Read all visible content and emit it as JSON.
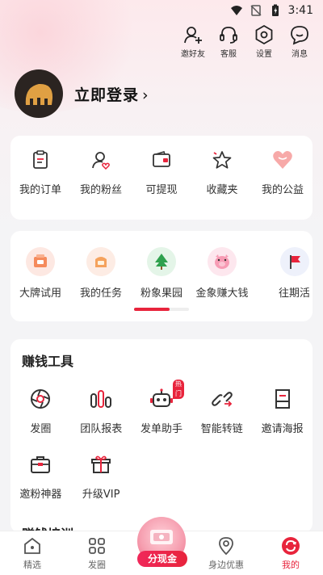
{
  "status_bar": {
    "time": "3:41"
  },
  "header_actions": [
    {
      "label": "邀好友",
      "icon": "add-user-icon"
    },
    {
      "label": "客服",
      "icon": "headset-icon"
    },
    {
      "label": "设置",
      "icon": "settings-icon"
    },
    {
      "label": "消息",
      "icon": "message-icon"
    }
  ],
  "profile": {
    "login_label": "立即登录",
    "chevron": "›"
  },
  "my_items": [
    {
      "label": "我的订单",
      "icon": "order-icon"
    },
    {
      "label": "我的粉丝",
      "icon": "fans-icon"
    },
    {
      "label": "可提现",
      "icon": "wallet-icon"
    },
    {
      "label": "收藏夹",
      "icon": "star-icon"
    },
    {
      "label": "我的公益",
      "icon": "heart-icon"
    }
  ],
  "activities": [
    {
      "label": "大牌试用",
      "icon": "trial-icon"
    },
    {
      "label": "我的任务",
      "icon": "task-icon"
    },
    {
      "label": "粉象果园",
      "icon": "tree-icon"
    },
    {
      "label": "金象赚大钱",
      "icon": "pig-icon"
    },
    {
      "label": "往期活",
      "icon": "flag-icon"
    }
  ],
  "tools": {
    "title": "赚钱工具",
    "hot_badge": "热门",
    "items": [
      {
        "label": "发圈",
        "icon": "shutter-icon"
      },
      {
        "label": "团队报表",
        "icon": "bar-chart-icon"
      },
      {
        "label": "发单助手",
        "icon": "robot-icon"
      },
      {
        "label": "智能转链",
        "icon": "link-icon"
      },
      {
        "label": "邀请海报",
        "icon": "poster-icon"
      },
      {
        "label": "邀粉神器",
        "icon": "briefcase-icon"
      },
      {
        "label": "升级VIP",
        "icon": "gift-icon"
      }
    ]
  },
  "next_section_title": "赚钱培训",
  "bottom_nav": [
    {
      "label": "精选",
      "icon": "home-icon"
    },
    {
      "label": "发圈",
      "icon": "grid-icon"
    },
    {
      "label": "分现金",
      "icon": "cash-icon"
    },
    {
      "label": "身边优惠",
      "icon": "location-icon"
    },
    {
      "label": "我的",
      "icon": "mine-icon"
    }
  ],
  "colors": {
    "accent": "#e8243c",
    "background": "#f4f4f6"
  }
}
